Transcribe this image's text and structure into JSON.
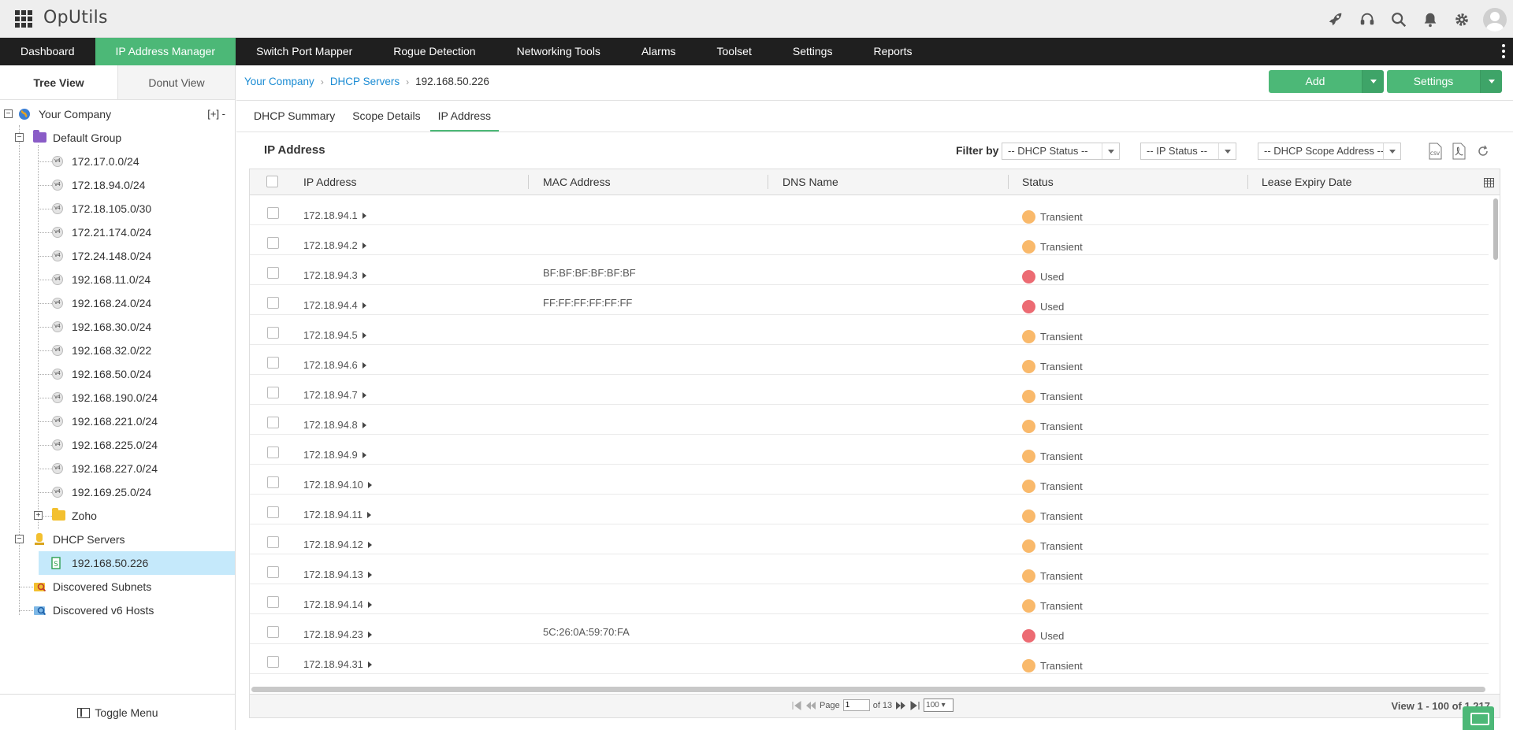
{
  "app": {
    "title": "OpUtils"
  },
  "nav": {
    "items": [
      {
        "label": "Dashboard"
      },
      {
        "label": "IP Address Manager"
      },
      {
        "label": "Switch Port Mapper"
      },
      {
        "label": "Rogue Detection"
      },
      {
        "label": "Networking Tools"
      },
      {
        "label": "Alarms"
      },
      {
        "label": "Toolset"
      },
      {
        "label": "Settings"
      },
      {
        "label": "Reports"
      }
    ],
    "active": "IP Address Manager"
  },
  "sidebar": {
    "tabs": {
      "tree": "Tree View",
      "donut": "Donut View"
    },
    "root": "Your Company",
    "expand_collapse": "[+]  -",
    "group": "Default Group",
    "subnets": [
      "172.17.0.0/24",
      "172.18.94.0/24",
      "172.18.105.0/30",
      "172.21.174.0/24",
      "172.24.148.0/24",
      "192.168.11.0/24",
      "192.168.24.0/24",
      "192.168.30.0/24",
      "192.168.32.0/22",
      "192.168.50.0/24",
      "192.168.190.0/24",
      "192.168.221.0/24",
      "192.168.225.0/24",
      "192.168.227.0/24",
      "192.169.25.0/24"
    ],
    "zoho": "Zoho",
    "dhcp_servers": "DHCP Servers",
    "dhcp_server_ip": "192.168.50.226",
    "discovered_subnets": "Discovered Subnets",
    "discovered_v6": "Discovered v6 Hosts",
    "v4_badge": "v4",
    "toggle_menu": "Toggle Menu"
  },
  "breadcrumb": {
    "company": "Your Company",
    "servers": "DHCP Servers",
    "current": "192.168.50.226"
  },
  "buttons": {
    "add": "Add",
    "settings": "Settings"
  },
  "subtabs": [
    {
      "label": "DHCP Summary"
    },
    {
      "label": "Scope Details"
    },
    {
      "label": "IP Address"
    }
  ],
  "panel": {
    "title": "IP Address",
    "filter_label": "Filter by",
    "filters": {
      "dhcp_status": "-- DHCP Status --",
      "ip_status": "-- IP Status --",
      "scope": "-- DHCP Scope Address --"
    }
  },
  "table": {
    "columns": {
      "ip": "IP Address",
      "mac": "MAC Address",
      "dns": "DNS Name",
      "status": "Status",
      "lease": "Lease Expiry Date"
    },
    "rows": [
      {
        "ip": "172.18.94.1",
        "mac": "",
        "status": "Transient"
      },
      {
        "ip": "172.18.94.2",
        "mac": "",
        "status": "Transient"
      },
      {
        "ip": "172.18.94.3",
        "mac": "BF:BF:BF:BF:BF:BF",
        "status": "Used"
      },
      {
        "ip": "172.18.94.4",
        "mac": "FF:FF:FF:FF:FF:FF",
        "status": "Used"
      },
      {
        "ip": "172.18.94.5",
        "mac": "",
        "status": "Transient"
      },
      {
        "ip": "172.18.94.6",
        "mac": "",
        "status": "Transient"
      },
      {
        "ip": "172.18.94.7",
        "mac": "",
        "status": "Transient"
      },
      {
        "ip": "172.18.94.8",
        "mac": "",
        "status": "Transient"
      },
      {
        "ip": "172.18.94.9",
        "mac": "",
        "status": "Transient"
      },
      {
        "ip": "172.18.94.10",
        "mac": "",
        "status": "Transient"
      },
      {
        "ip": "172.18.94.11",
        "mac": "",
        "status": "Transient"
      },
      {
        "ip": "172.18.94.12",
        "mac": "",
        "status": "Transient"
      },
      {
        "ip": "172.18.94.13",
        "mac": "",
        "status": "Transient"
      },
      {
        "ip": "172.18.94.14",
        "mac": "",
        "status": "Transient"
      },
      {
        "ip": "172.18.94.23",
        "mac": "5C:26:0A:59:70:FA",
        "status": "Used"
      },
      {
        "ip": "172.18.94.31",
        "mac": "",
        "status": "Transient"
      }
    ]
  },
  "status_colors": {
    "Transient": "#f9b96b",
    "Used": "#ec6b73"
  },
  "colors": {
    "accent": "#4cb877",
    "nav_bg": "#1f1f1f",
    "link": "#1a8bd3",
    "selected_row": "#c5e9fb"
  },
  "pager": {
    "page_label": "Page",
    "page_value": "1",
    "of_label": "of 13",
    "page_size": "100",
    "view_count": "View 1 - 100 of 1,217"
  },
  "icons": [
    "grid-icon",
    "rocket-icon",
    "headset-icon",
    "search-icon",
    "bell-icon",
    "gear-icon",
    "avatar-icon",
    "csv-icon",
    "pdf-icon",
    "refresh-icon",
    "column-chooser-icon",
    "chat-icon"
  ]
}
